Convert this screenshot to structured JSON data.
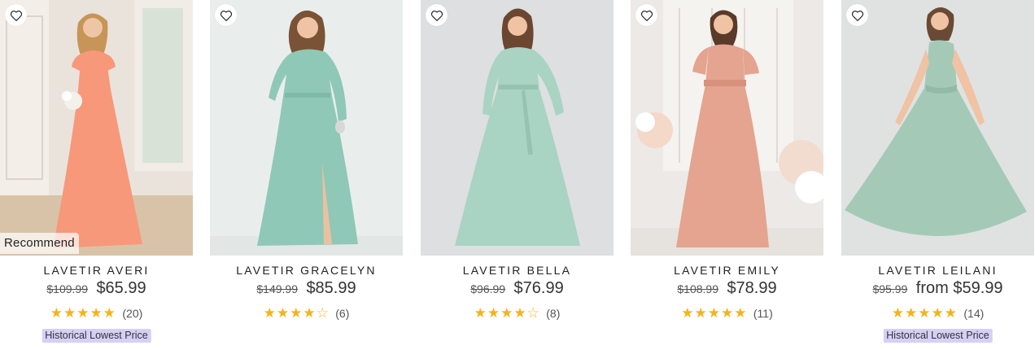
{
  "colors": {
    "star": "#f5b31a",
    "badge_bg": "#d6d0f7",
    "card_bg": "#ffffff"
  },
  "products": [
    {
      "brand": "LAVETIR",
      "name": "LAVETIR AVERI",
      "original_price": "$109.99",
      "price": "$65.99",
      "rating": 5,
      "stars": "★★★★★",
      "review_count": "(20)",
      "overlay_tag": "Recommend",
      "badge": "Historical Lowest Price",
      "dress_color": "#f7987a",
      "bg_color": "#eae3dc",
      "favorite_icon": "heart-outline-icon"
    },
    {
      "brand": "LAVETIR",
      "name": "LAVETIR GRACELYN",
      "original_price": "$149.99",
      "price": "$85.99",
      "rating": 4,
      "stars": "★★★★☆",
      "review_count": "(6)",
      "overlay_tag": "",
      "badge": "",
      "dress_color": "#8fc8b6",
      "bg_color": "#e9eeec",
      "favorite_icon": "heart-outline-icon"
    },
    {
      "brand": "LAVETIR",
      "name": "LAVETIR BELLA",
      "original_price": "$96.99",
      "price": "$76.99",
      "rating": 4,
      "stars": "★★★★☆",
      "review_count": "(8)",
      "overlay_tag": "",
      "badge": "",
      "dress_color": "#a9d3c2",
      "bg_color": "#dedfe1",
      "favorite_icon": "heart-outline-icon"
    },
    {
      "brand": "LAVETIR",
      "name": "LAVETIR EMILY",
      "original_price": "$108.99",
      "price": "$78.99",
      "rating": 5,
      "stars": "★★★★★",
      "review_count": "(11)",
      "overlay_tag": "",
      "badge": "",
      "dress_color": "#e4a48f",
      "bg_color": "#ece9e6",
      "favorite_icon": "heart-outline-icon"
    },
    {
      "brand": "LAVETIR",
      "name": "LAVETIR LEILANI",
      "original_price": "$95.99",
      "price": "from $59.99",
      "rating": 5,
      "stars": "★★★★★",
      "review_count": "(14)",
      "overlay_tag": "",
      "badge": "Historical Lowest Price",
      "dress_color": "#a4cab7",
      "bg_color": "#e0e2e2",
      "favorite_icon": "heart-outline-icon"
    }
  ]
}
